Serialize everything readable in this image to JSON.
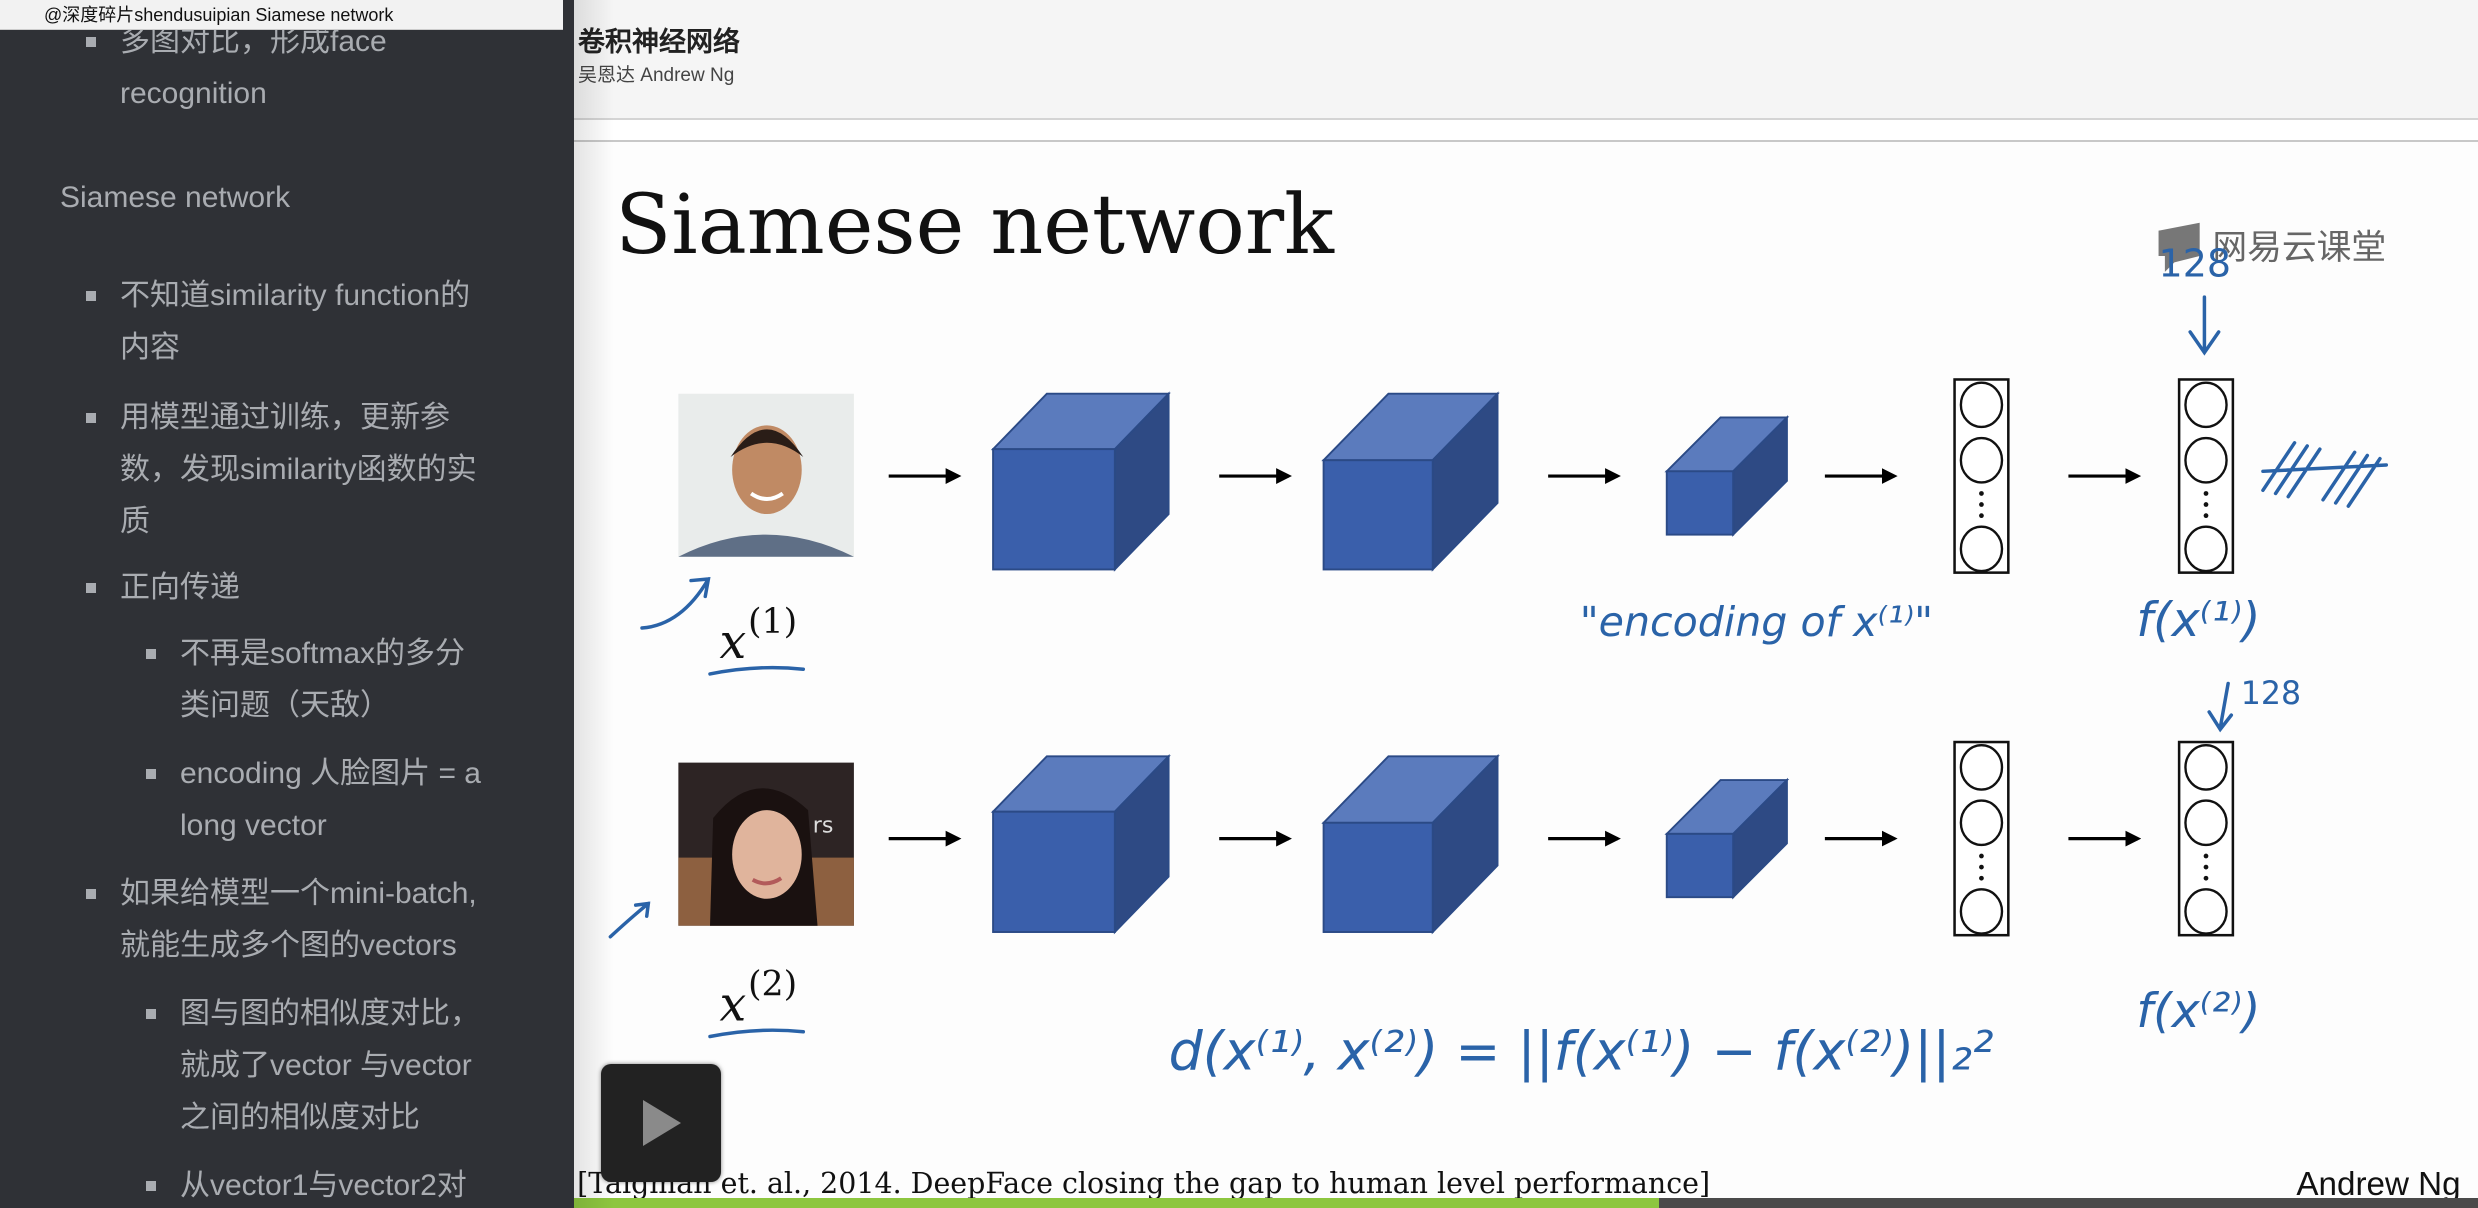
{
  "window": {
    "title_tab": "@深度碎片shendusuipian Siamese network"
  },
  "sidebar": {
    "items": [
      {
        "level": 1,
        "lines": [
          "多图对比，形成face",
          "recognition"
        ]
      },
      {
        "level": 0,
        "heading": "Siamese network"
      },
      {
        "level": 1,
        "lines": [
          "不知道similarity function的",
          "内容"
        ]
      },
      {
        "level": 1,
        "lines": [
          "用模型通过训练，更新参",
          "数，发现similarity函数的实",
          "质"
        ]
      },
      {
        "level": 1,
        "lines": [
          "正向传递"
        ]
      },
      {
        "level": 2,
        "lines": [
          "不再是softmax的多分",
          "类问题（天敌）"
        ]
      },
      {
        "level": 2,
        "lines": [
          "encoding 人脸图片 = a",
          "long vector"
        ]
      },
      {
        "level": 1,
        "lines": [
          "如果给模型一个mini-batch,",
          "就能生成多个图的vectors"
        ]
      },
      {
        "level": 2,
        "lines": [
          "图与图的相似度对比，",
          "就成了vector 与vector",
          "之间的相似度对比"
        ]
      },
      {
        "level": 2,
        "lines": [
          "从vector1与vector2对"
        ]
      }
    ]
  },
  "header": {
    "course_title": "卷积神经网络",
    "instructor": "吴恩达 Andrew Ng"
  },
  "slide": {
    "title": "Siamese network",
    "watermark": "网易云课堂",
    "row1": {
      "input_label": "x",
      "input_sup": "(1)",
      "encoding_note": "\"encoding of x⁽¹⁾\"",
      "output_label": "f(x⁽¹⁾)",
      "dim_note": "128"
    },
    "row2": {
      "input_label": "x",
      "input_sup": "(2)",
      "output_label": "f(x⁽²⁾)",
      "dim_note": "128"
    },
    "distance_formula": "d(x⁽¹⁾, x⁽²⁾) = ||f(x⁽¹⁾) − f(x⁽²⁾)||₂²",
    "citation": "[Taigman et. al., 2014. DeepFace closing the gap to human level performance]",
    "author": "Andrew Ng",
    "colors": {
      "cube_front": "#3a5fab",
      "cube_top": "#5b7bbd",
      "cube_side": "#2e4a84",
      "ink": "#2a63a8"
    }
  },
  "player": {
    "play_label": "play",
    "progress_percent": 57,
    "progress_color": "#8dc63f"
  }
}
